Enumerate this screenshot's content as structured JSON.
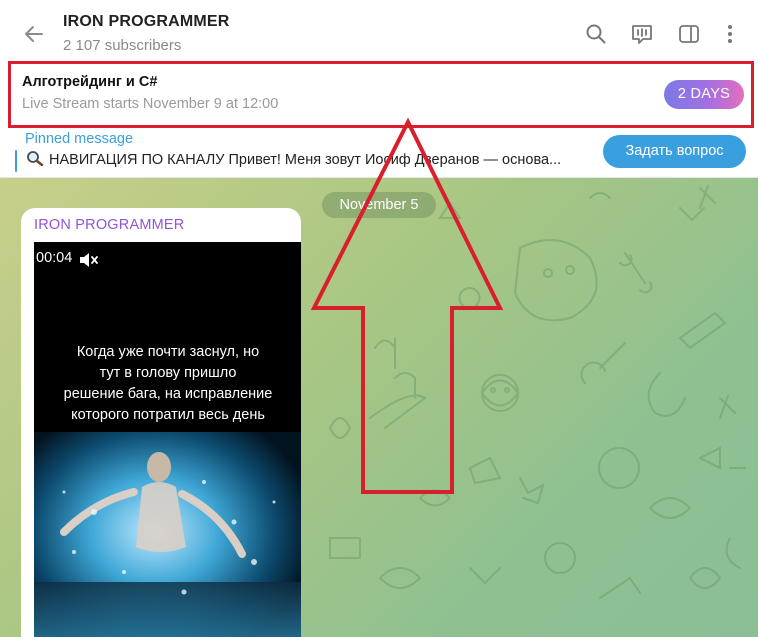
{
  "header": {
    "back_icon": "arrow-left-icon",
    "title": "IRON PROGRAMMER",
    "subscribers": "2 107 subscribers",
    "icons": [
      "search-icon",
      "live-stream-icon",
      "sidebar-toggle-icon",
      "more-vertical-icon"
    ]
  },
  "live_stream": {
    "title": "Алготрейдинг и C#",
    "subtitle": "Live Stream starts November 9 at 12:00",
    "badge": "2 DAYS"
  },
  "pinned": {
    "label": "Pinned message",
    "text": "НАВИГАЦИЯ ПО КАНАЛУ  Привет! Меня зовут Иосиф Дзеранов — основа...",
    "button": "Задать вопрос"
  },
  "chat": {
    "date": "November 5",
    "message": {
      "author": "IRON PROGRAMMER",
      "video_time": "00:04",
      "video_caption": "Когда уже почти заснул, но\nтут в голову пришло\nрешение бага, на исправление\nкоторого потратил весь день"
    }
  },
  "colors": {
    "accent": "#3a9fde",
    "author": "#8f55d5",
    "highlight": "#d91f2d",
    "badge_start": "#7b7ae6",
    "badge_end": "#e36fbf"
  }
}
